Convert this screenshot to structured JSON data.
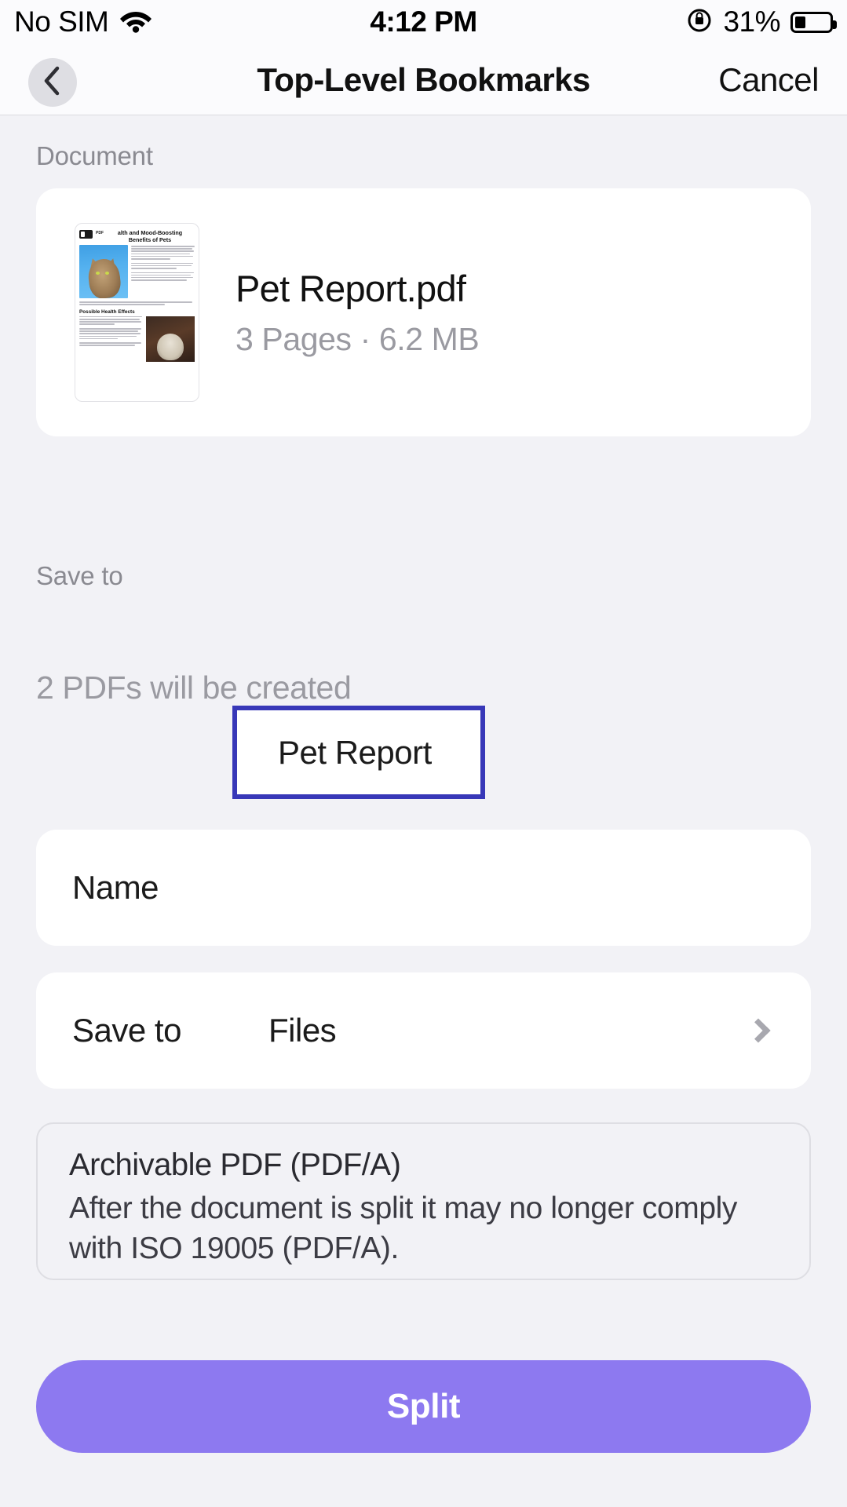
{
  "status_bar": {
    "carrier": "No SIM",
    "wifi_icon": "wifi-icon",
    "time": "4:12 PM",
    "rotation_lock_icon": "rotation-lock-icon",
    "battery_percent": "31%",
    "battery_level": 31
  },
  "nav_bar": {
    "back_icon": "chevron-left-icon",
    "title": "Top-Level Bookmarks",
    "cancel_label": "Cancel"
  },
  "document_section": {
    "label": "Document",
    "thumbnail": {
      "logo_text": "PDF",
      "page_title": "alth and Mood-Boosting Benefits of Pets",
      "subheading": "Possible Health Effects"
    },
    "file_name": "Pet Report.pdf",
    "file_meta": "3 Pages · 6.2 MB",
    "pages": "3 Pages",
    "size": "6.2 MB"
  },
  "split_note": "2 PDFs will be created",
  "save_section": {
    "label": "Save to",
    "name_row": {
      "label": "Name",
      "value": "Pet Report",
      "focused": true,
      "focus_color": "#3838b8"
    },
    "destination_row": {
      "label": "Save to",
      "value": "Files",
      "chevron_icon": "chevron-right-icon"
    }
  },
  "info_box": {
    "title": "Archivable PDF (PDF/A)",
    "description": "After the document is split it may no longer comply with ISO 19005 (PDF/A)."
  },
  "primary_action": {
    "label": "Split",
    "color": "#8d79f0"
  }
}
